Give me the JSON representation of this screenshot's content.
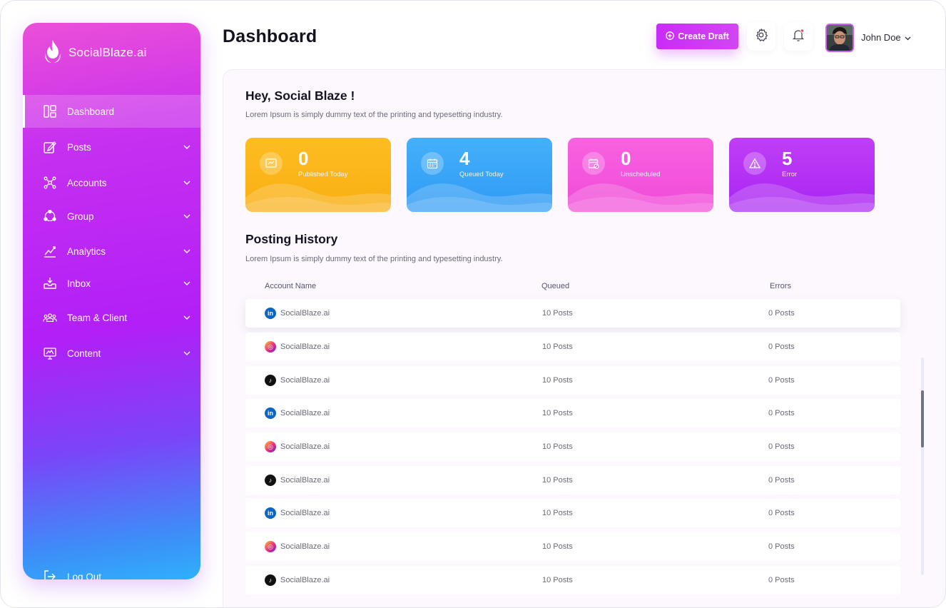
{
  "brand": {
    "name": "SocialBlaze.ai"
  },
  "sidebar": {
    "items": [
      {
        "label": "Dashboard",
        "icon": "dashboard-icon",
        "active": true
      },
      {
        "label": "Posts",
        "icon": "edit-icon"
      },
      {
        "label": "Accounts",
        "icon": "network-icon"
      },
      {
        "label": "Group",
        "icon": "group-icon"
      },
      {
        "label": "Analytics",
        "icon": "chart-icon"
      },
      {
        "label": "Inbox",
        "icon": "inbox-icon"
      },
      {
        "label": "Team & Client",
        "icon": "team-icon"
      },
      {
        "label": "Content",
        "icon": "content-icon"
      }
    ],
    "logout": "Log Out"
  },
  "header": {
    "title": "Dashboard",
    "create_label": "Create Draft",
    "user_name": "John Doe"
  },
  "greeting": {
    "title": "Hey, Social Blaze !",
    "subtitle": "Lorem Ipsum is simply dummy text of the printing and typesetting industry."
  },
  "stats": [
    {
      "value": "0",
      "label": "Published Today",
      "color": "#fbb616",
      "icon": "published-icon"
    },
    {
      "value": "4",
      "label": "Queued Today",
      "color": "#3aa6f7",
      "icon": "calendar-icon"
    },
    {
      "value": "0",
      "label": "Unscheduled",
      "color": "#f45adc",
      "icon": "unscheduled-icon"
    },
    {
      "value": "5",
      "label": "Error",
      "color": "#b32bf4",
      "icon": "warning-icon"
    }
  ],
  "history": {
    "title": "Posting History",
    "subtitle": "Lorem Ipsum is simply dummy text of the printing and typesetting industry.",
    "columns": [
      "Account Name",
      "Queued",
      "Errors"
    ],
    "rows": [
      {
        "network": "linkedin",
        "account": "SocialBlaze.ai",
        "queued": "10 Posts",
        "errors": "0 Posts"
      },
      {
        "network": "instagram",
        "account": "SocialBlaze.ai",
        "queued": "10 Posts",
        "errors": "0 Posts"
      },
      {
        "network": "tiktok",
        "account": "SocialBlaze.ai",
        "queued": "10 Posts",
        "errors": "0 Posts"
      },
      {
        "network": "linkedin",
        "account": "SocialBlaze.ai",
        "queued": "10 Posts",
        "errors": "0 Posts"
      },
      {
        "network": "instagram",
        "account": "SocialBlaze.ai",
        "queued": "10 Posts",
        "errors": "0 Posts"
      },
      {
        "network": "tiktok",
        "account": "SocialBlaze.ai",
        "queued": "10 Posts",
        "errors": "0 Posts"
      },
      {
        "network": "linkedin",
        "account": "SocialBlaze.ai",
        "queued": "10 Posts",
        "errors": "0 Posts"
      },
      {
        "network": "instagram",
        "account": "SocialBlaze.ai",
        "queued": "10 Posts",
        "errors": "0 Posts"
      },
      {
        "network": "tiktok",
        "account": "SocialBlaze.ai",
        "queued": "10 Posts",
        "errors": "0 Posts"
      }
    ]
  }
}
